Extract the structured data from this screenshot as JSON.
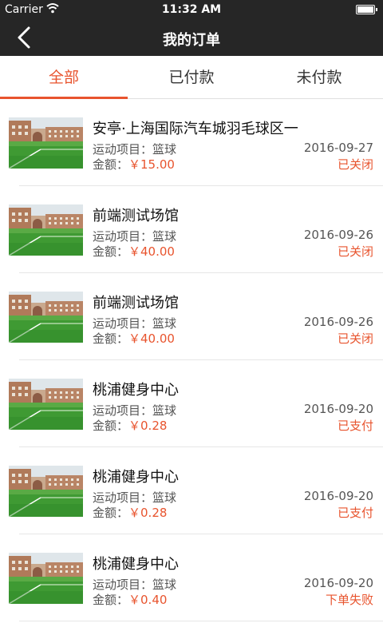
{
  "status_bar": {
    "carrier": "Carrier",
    "time": "11:32 AM",
    "icons": [
      "wifi-icon",
      "battery-icon"
    ]
  },
  "nav": {
    "title": "我的订单",
    "back_icon": "chevron-left-icon"
  },
  "tabs": [
    {
      "label": "全部",
      "active": true
    },
    {
      "label": "已付款",
      "active": false
    },
    {
      "label": "未付款",
      "active": false
    }
  ],
  "colors": {
    "accent": "#e8542e",
    "bar": "#262626"
  },
  "orders": [
    {
      "venue": "安亭·上海国际汽车城羽毛球区一",
      "sport_label": "运动项目：",
      "sport": "篮球",
      "amount_label": "金额：",
      "price": "￥15.00",
      "date": "2016-09-27",
      "status": "已关闭"
    },
    {
      "venue": "前端测试场馆",
      "sport_label": "运动项目：",
      "sport": "篮球",
      "amount_label": "金额：",
      "price": "￥40.00",
      "date": "2016-09-26",
      "status": "已关闭"
    },
    {
      "venue": "前端测试场馆",
      "sport_label": "运动项目：",
      "sport": "篮球",
      "amount_label": "金额：",
      "price": "￥40.00",
      "date": "2016-09-26",
      "status": "已关闭"
    },
    {
      "venue": "桃浦健身中心",
      "sport_label": "运动项目：",
      "sport": "篮球",
      "amount_label": "金额：",
      "price": "￥0.28",
      "date": "2016-09-20",
      "status": "已支付"
    },
    {
      "venue": "桃浦健身中心",
      "sport_label": "运动项目：",
      "sport": "篮球",
      "amount_label": "金额：",
      "price": "￥0.28",
      "date": "2016-09-20",
      "status": "已支付"
    },
    {
      "venue": "桃浦健身中心",
      "sport_label": "运动项目：",
      "sport": "篮球",
      "amount_label": "金额：",
      "price": "￥0.40",
      "date": "2016-09-20",
      "status": "下单失败"
    }
  ]
}
